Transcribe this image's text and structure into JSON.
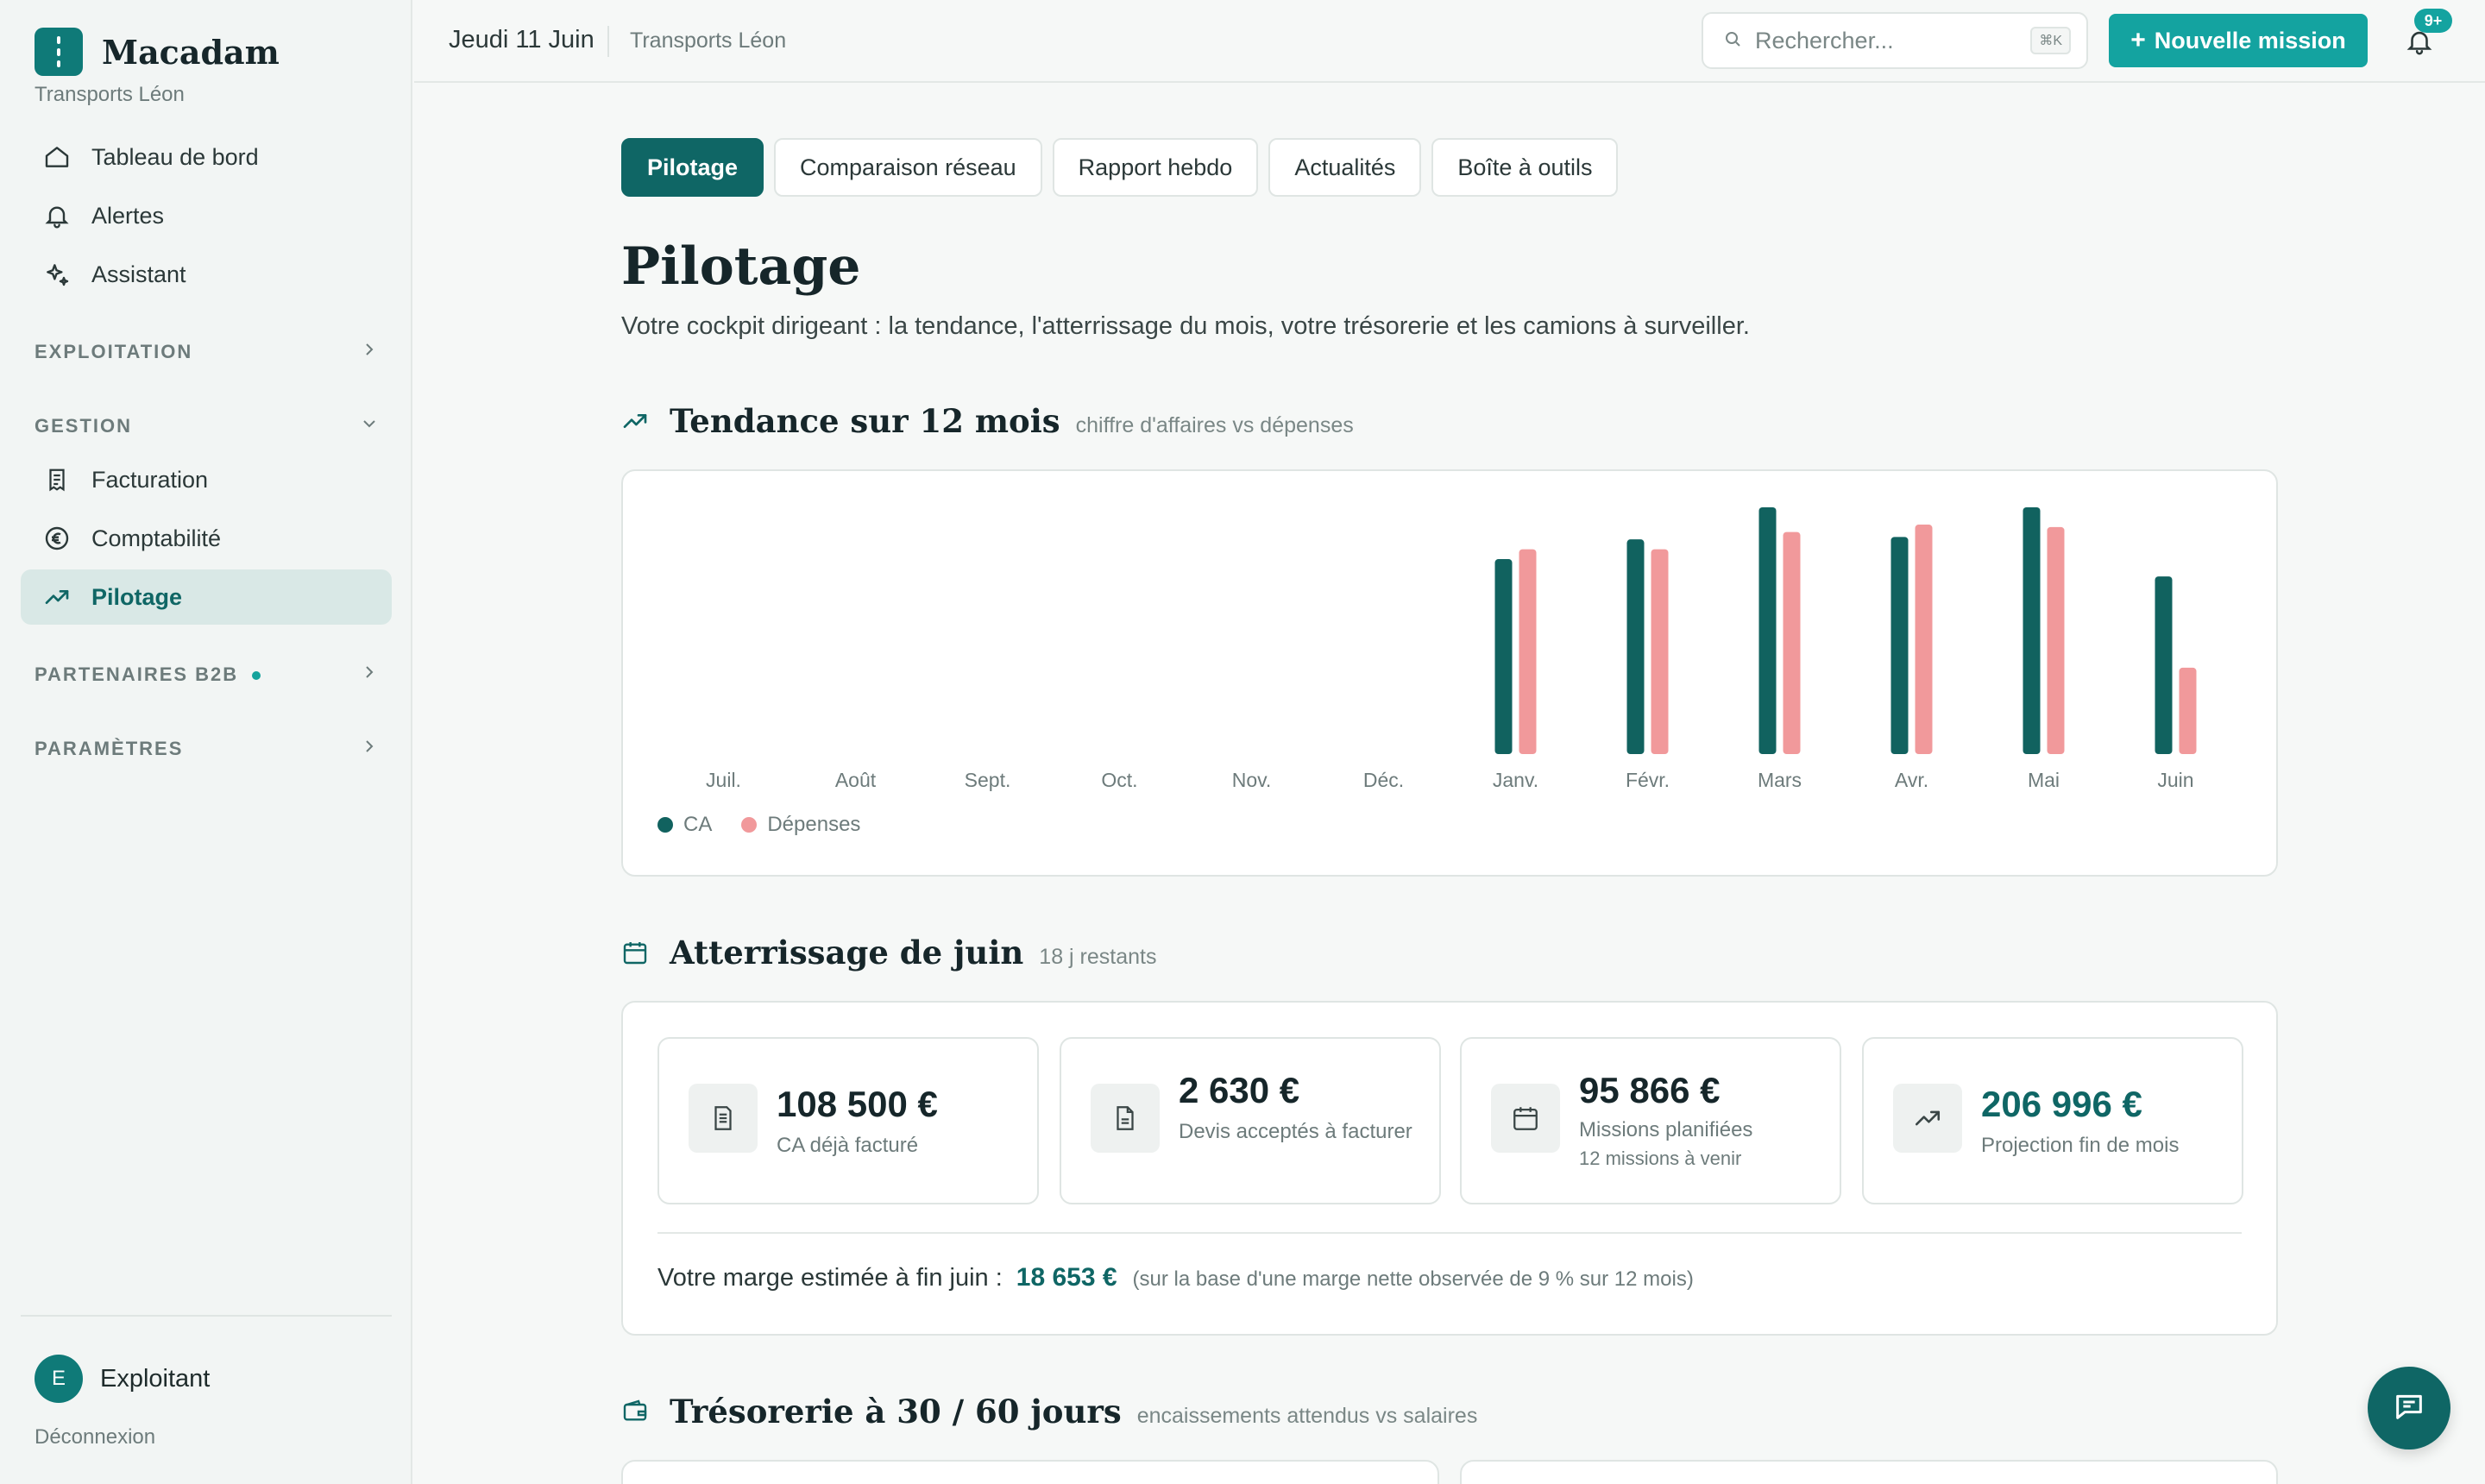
{
  "sidebar": {
    "brand_name": "Macadam",
    "company": "Transports Léon",
    "nav_top": [
      {
        "label": "Tableau de bord",
        "icon": "home-icon"
      },
      {
        "label": "Alertes",
        "icon": "bell-icon"
      },
      {
        "label": "Assistant",
        "icon": "sparkle-icon"
      }
    ],
    "sections": {
      "exploitation": "EXPLOITATION",
      "gestion": "GESTION",
      "partenaires": "PARTENAIRES B2B",
      "parametres": "PARAMÈTRES"
    },
    "gestion_items": [
      {
        "label": "Facturation",
        "icon": "invoice-icon"
      },
      {
        "label": "Comptabilité",
        "icon": "euro-icon"
      },
      {
        "label": "Pilotage",
        "icon": "trend-icon",
        "active": true
      }
    ],
    "user": {
      "initial": "E",
      "name": "Exploitant"
    },
    "logout": "Déconnexion"
  },
  "topbar": {
    "date": "Jeudi 11 Juin",
    "company": "Transports Léon",
    "search_placeholder": "Rechercher...",
    "search_shortcut": "⌘K",
    "new_button": "Nouvelle mission",
    "new_button_plus": "+",
    "notifications_badge": "9+"
  },
  "tabs": [
    "Pilotage",
    "Comparaison réseau",
    "Rapport hebdo",
    "Actualités",
    "Boîte à outils"
  ],
  "page": {
    "title": "Pilotage",
    "subtitle": "Votre cockpit dirigeant : la tendance, l'atterrissage du mois, votre trésorerie et les camions à surveiller."
  },
  "trend": {
    "title": "Tendance sur 12 mois",
    "note": "chiffre d'affaires vs dépenses"
  },
  "chart_data": {
    "type": "bar",
    "categories": [
      "Juil.",
      "Août",
      "Sept.",
      "Oct.",
      "Nov.",
      "Déc.",
      "Janv.",
      "Févr.",
      "Mars",
      "Avr.",
      "Mai",
      "Juin"
    ],
    "series": [
      {
        "name": "CA",
        "color": "#11625f",
        "values": [
          0,
          0,
          0,
          0,
          0,
          0,
          79,
          87,
          100,
          88,
          100,
          72
        ]
      },
      {
        "name": "Dépenses",
        "color": "#f1999b",
        "values": [
          0,
          0,
          0,
          0,
          0,
          0,
          83,
          83,
          90,
          93,
          92,
          35
        ]
      }
    ],
    "ylim": [
      0,
      100
    ],
    "grid": false,
    "legend": "bottom-left"
  },
  "landing": {
    "title": "Atterrissage de juin",
    "note": "18 j restants",
    "kpis": [
      {
        "value": "108 500 €",
        "label": "CA déjà facturé",
        "icon": "document-icon"
      },
      {
        "value": "2 630 €",
        "label": "Devis acceptés à facturer",
        "icon": "file-icon"
      },
      {
        "value": "95 866 €",
        "label": "Missions planifiées",
        "sub": "12 missions à venir",
        "icon": "calendar-icon"
      },
      {
        "value": "206 996 €",
        "label": "Projection fin de mois",
        "icon": "trend-icon",
        "accent": true
      }
    ],
    "margin_label": "Votre marge estimée à fin juin :",
    "margin_value": "18 653 €",
    "margin_note": "(sur la base d'une marge nette observée de 9 % sur 12 mois)"
  },
  "treasury": {
    "title": "Trésorerie à 30 / 60 jours",
    "note": "encaissements attendus vs salaires"
  }
}
